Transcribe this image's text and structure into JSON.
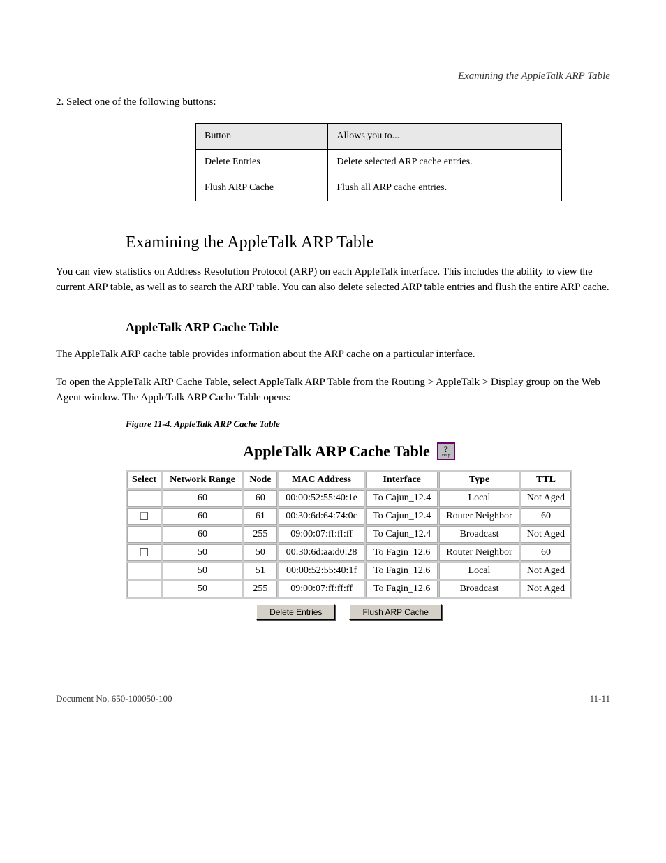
{
  "header": {
    "right": "Examining the AppleTalk ARP Table"
  },
  "intro_para": "2. Select one of the following buttons:",
  "buttons_table": {
    "headers": [
      "Button",
      "Allows you to..."
    ],
    "rows": [
      {
        "button": "Delete Entries",
        "desc": "Delete selected ARP cache entries."
      },
      {
        "button": "Flush ARP Cache",
        "desc": "Flush all ARP cache entries."
      }
    ]
  },
  "section_title": "Examining the AppleTalk ARP Table",
  "section_para": "You can view statistics on Address Resolution Protocol (ARP) on each AppleTalk interface. This includes the ability to view the current ARP table, as well as to search the ARP table. You can also delete selected ARP table entries and flush the entire ARP cache.",
  "subsection_title": "AppleTalk ARP Cache Table",
  "sub_para_1": "The AppleTalk ARP cache table provides information about the ARP cache on a particular interface.",
  "sub_para_2": "To open the AppleTalk ARP Cache Table, select AppleTalk ARP Table from the Routing > AppleTalk > Display group on the Web Agent window. The AppleTalk ARP Cache Table opens:",
  "figure_caption": "Figure 11-4.  AppleTalk ARP Cache Table",
  "arp": {
    "title": "AppleTalk ARP Cache Table",
    "help_q": "?",
    "help_label": "Help",
    "headers": [
      "Select",
      "Network Range",
      "Node",
      "MAC Address",
      "Interface",
      "Type",
      "TTL"
    ],
    "rows": [
      {
        "selectable": false,
        "net": "60",
        "node": "60",
        "mac": "00:00:52:55:40:1e",
        "iface": "To Cajun_12.4",
        "type": "Local",
        "ttl": "Not Aged"
      },
      {
        "selectable": true,
        "net": "60",
        "node": "61",
        "mac": "00:30:6d:64:74:0c",
        "iface": "To Cajun_12.4",
        "type": "Router Neighbor",
        "ttl": "60"
      },
      {
        "selectable": false,
        "net": "60",
        "node": "255",
        "mac": "09:00:07:ff:ff:ff",
        "iface": "To Cajun_12.4",
        "type": "Broadcast",
        "ttl": "Not Aged"
      },
      {
        "selectable": true,
        "net": "50",
        "node": "50",
        "mac": "00:30:6d:aa:d0:28",
        "iface": "To Fagin_12.6",
        "type": "Router Neighbor",
        "ttl": "60"
      },
      {
        "selectable": false,
        "net": "50",
        "node": "51",
        "mac": "00:00:52:55:40:1f",
        "iface": "To Fagin_12.6",
        "type": "Local",
        "ttl": "Not Aged"
      },
      {
        "selectable": false,
        "net": "50",
        "node": "255",
        "mac": "09:00:07:ff:ff:ff",
        "iface": "To Fagin_12.6",
        "type": "Broadcast",
        "ttl": "Not Aged"
      }
    ],
    "buttons": {
      "delete": "Delete Entries",
      "flush": "Flush ARP Cache"
    }
  },
  "footer": {
    "left": "Document No. 650-100050-100",
    "right": "11-11"
  }
}
